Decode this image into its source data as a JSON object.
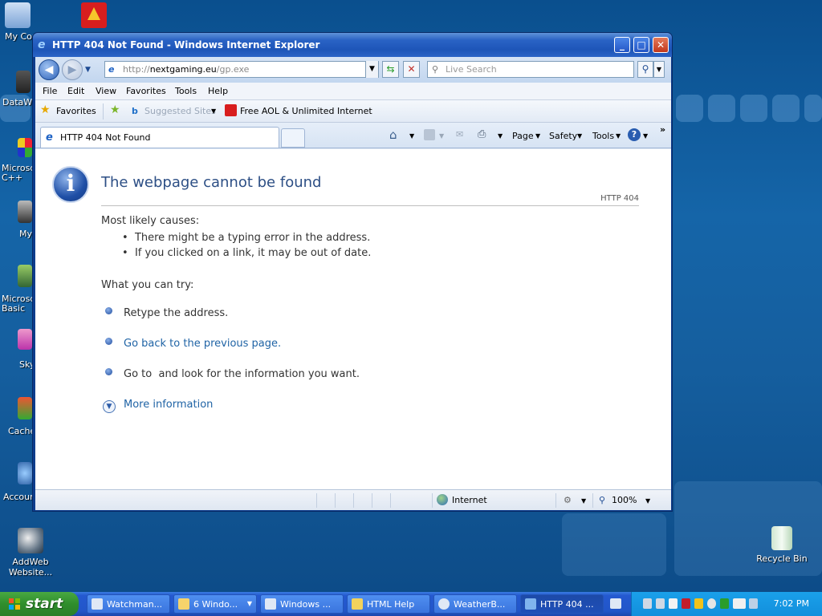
{
  "desktop": {
    "icons": [
      {
        "label": "My Com",
        "icon": "my-computer-icon"
      },
      {
        "label": "DataWa",
        "icon": "datawa-shortcut-icon"
      },
      {
        "label": "Microsol\nC++",
        "icon": "visual-cpp-icon"
      },
      {
        "label": "My",
        "icon": "my-shortcut-icon"
      },
      {
        "label": "Microsol\nBasic",
        "icon": "visual-basic-icon"
      },
      {
        "label": "Sky",
        "icon": "skype-icon"
      },
      {
        "label": "Cache",
        "icon": "cache-icon"
      },
      {
        "label": "Accoun",
        "icon": "accounting-icon"
      },
      {
        "label": "AddWeb\nWebsite...",
        "icon": "addweb-icon"
      },
      {
        "label": "Recycle Bin",
        "icon": "recycle-bin-icon"
      }
    ]
  },
  "window": {
    "title": "HTTP 404 Not Found - Windows Internet Explorer",
    "controls": {
      "minimize": "_",
      "maximize": "□",
      "close": "✕"
    }
  },
  "address_bar": {
    "url_prefix": "http://",
    "url_host": "nextgaming.eu",
    "url_path": "/gp.exe",
    "search_placeholder": "Live Search"
  },
  "menu": [
    "File",
    "Edit",
    "View",
    "Favorites",
    "Tools",
    "Help"
  ],
  "favorites_bar": {
    "favorites_label": "Favorites",
    "suggested_label": "Suggested Sites",
    "aol_label": "Free AOL & Unlimited Internet"
  },
  "tab": {
    "title": "HTTP 404 Not Found"
  },
  "command_bar": {
    "page": "Page",
    "safety": "Safety",
    "tools": "Tools"
  },
  "page": {
    "heading": "The webpage cannot be found",
    "code": "HTTP 404",
    "causes_label": "Most likely causes:",
    "causes": [
      "There might be a typing error in the address.",
      "If you clicked on a link, it may be out of date."
    ],
    "try_label": "What you can try:",
    "actions": [
      {
        "text": "Retype the address.",
        "link": false
      },
      {
        "text": "Go back to the previous page.",
        "link": true
      },
      {
        "text": "Go to  and look for the information you want.",
        "link": false
      }
    ],
    "more_info": "More information"
  },
  "status_bar": {
    "zone": "Internet",
    "zoom": "100%"
  },
  "taskbar": {
    "start_label": "start",
    "tasks": [
      "Watchman...",
      "6 Windo...",
      "Windows ...",
      "HTML Help",
      "WeatherB...",
      "HTTP 404 ..."
    ],
    "clock": "7:02 PM"
  },
  "colors": {
    "titlebar": "#2a63c5",
    "link": "#1f63a5",
    "heading": "#2d4f85",
    "start_green": "#2f8e2c"
  }
}
